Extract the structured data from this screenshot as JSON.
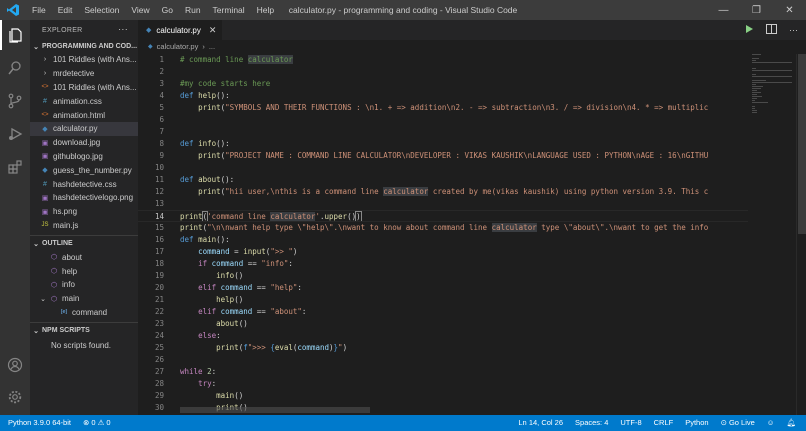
{
  "titlebar": {
    "menu": [
      "File",
      "Edit",
      "Selection",
      "View",
      "Go",
      "Run",
      "Terminal",
      "Help"
    ],
    "title": "calculator.py - programming and coding - Visual Studio Code"
  },
  "sidebar": {
    "header": "EXPLORER",
    "more": "···",
    "folder": "PROGRAMMING AND COD...",
    "files": [
      {
        "name": "101 Riddles (with Ans...",
        "icon": "folder-icon",
        "glyph": "›",
        "color": "#cccccc",
        "chevron": true
      },
      {
        "name": "mrdetective",
        "icon": "folder-icon",
        "glyph": "›",
        "color": "#cccccc",
        "chevron": true
      },
      {
        "name": "101 Riddles (with Ans...",
        "icon": "html-file-icon",
        "glyph": "<>",
        "color": "#e37933"
      },
      {
        "name": "animation.css",
        "icon": "css-file-icon",
        "glyph": "#",
        "color": "#519aba"
      },
      {
        "name": "animation.html",
        "icon": "html-file-icon",
        "glyph": "<>",
        "color": "#e37933"
      },
      {
        "name": "calculator.py",
        "icon": "python-file-icon",
        "glyph": "◆",
        "color": "#4584b6",
        "selected": true
      },
      {
        "name": "download.jpg",
        "icon": "image-file-icon",
        "glyph": "▣",
        "color": "#a074c4"
      },
      {
        "name": "githublogo.jpg",
        "icon": "image-file-icon",
        "glyph": "▣",
        "color": "#a074c4"
      },
      {
        "name": "guess_the_number.py",
        "icon": "python-file-icon",
        "glyph": "◆",
        "color": "#4584b6"
      },
      {
        "name": "hashdetective.css",
        "icon": "css-file-icon",
        "glyph": "#",
        "color": "#519aba"
      },
      {
        "name": "hashdetectivelogo.png",
        "icon": "image-file-icon",
        "glyph": "▣",
        "color": "#a074c4"
      },
      {
        "name": "hs.png",
        "icon": "image-file-icon",
        "glyph": "▣",
        "color": "#a074c4"
      },
      {
        "name": "main.js",
        "icon": "js-file-icon",
        "glyph": "JS",
        "color": "#cbcb41"
      }
    ],
    "outline_header": "OUTLINE",
    "outline": [
      {
        "name": "about",
        "indent": 1
      },
      {
        "name": "help",
        "indent": 1
      },
      {
        "name": "info",
        "indent": 1
      },
      {
        "name": "main",
        "indent": 1,
        "chevron": true
      },
      {
        "name": "command",
        "indent": 2,
        "variable": true
      }
    ],
    "npm_header": "NPM SCRIPTS",
    "npm_empty": "No scripts found."
  },
  "editor": {
    "tab": "calculator.py",
    "breadcrumb": [
      "calculator.py",
      "..."
    ],
    "current_line": 14,
    "lines": [
      {
        "n": 1,
        "html": "<span class='c-com'># command line <span class='hl'>calculator</span></span>"
      },
      {
        "n": 2,
        "html": ""
      },
      {
        "n": 3,
        "html": "<span class='c-com'>#my code starts here</span>"
      },
      {
        "n": 4,
        "html": "<span class='c-kw'>def</span> <span class='c-fn'>help</span>():"
      },
      {
        "n": 5,
        "html": "    <span class='c-fn'>print</span>(<span class='c-str'>\"SYMBOLS AND THEIR FUNCTIONS : \\n1. + =&gt; addition\\n2. - =&gt; subtraction\\n3. / =&gt; division\\n4. * =&gt; multiplic</span>"
      },
      {
        "n": 6,
        "html": ""
      },
      {
        "n": 7,
        "html": ""
      },
      {
        "n": 8,
        "html": "<span class='c-kw'>def</span> <span class='c-fn'>info</span>():"
      },
      {
        "n": 9,
        "html": "    <span class='c-fn'>print</span>(<span class='c-str'>\"PROJECT NAME : COMMAND LINE CALCULATOR\\nDEVELOPER : VIKAS KAUSHIK\\nLANGUAGE USED : PYTHON\\nAGE : 16\\nGITHU</span>"
      },
      {
        "n": 10,
        "html": ""
      },
      {
        "n": 11,
        "html": "<span class='c-kw'>def</span> <span class='c-fn'>about</span>():"
      },
      {
        "n": 12,
        "html": "    <span class='c-fn'>print</span>(<span class='c-str'>\"hii user,\\nthis is a command line <span class='hl'>calculator</span> created by me(vikas kaushik) using python version 3.9. This c</span>"
      },
      {
        "n": 13,
        "html": ""
      },
      {
        "n": 14,
        "html": "<span class='c-fn'>print</span><span style='outline:1px solid #888'>(</span><span class='c-str'>'command line <span class='hl'>calculator</span>'</span>.<span class='c-fn'>upper</span>()<span style='outline:1px solid #888'>)</span>"
      },
      {
        "n": 15,
        "html": "<span class='c-fn'>print</span>(<span class='c-str'>\"\\n\\nwant help type \\\"help\\\".\\nwant to know about command line <span class='hl'>calculator</span> type \\\"about\\\".\\nwant to get the info</span>"
      },
      {
        "n": 16,
        "html": "<span class='c-kw'>def</span> <span class='c-fn'>main</span>():"
      },
      {
        "n": 17,
        "html": "    <span class='c-var'>command</span> = <span class='c-fn'>input</span>(<span class='c-str'>\"&gt;&gt; \"</span>)"
      },
      {
        "n": 18,
        "html": "    <span class='c-ctl'>if</span> <span class='c-var'>command</span> == <span class='c-str'>\"info\"</span>:"
      },
      {
        "n": 19,
        "html": "        <span class='c-fn'>info</span>()"
      },
      {
        "n": 20,
        "html": "    <span class='c-ctl'>elif</span> <span class='c-var'>command</span> == <span class='c-str'>\"help\"</span>:"
      },
      {
        "n": 21,
        "html": "        <span class='c-fn'>help</span>()"
      },
      {
        "n": 22,
        "html": "    <span class='c-ctl'>elif</span> <span class='c-var'>command</span> == <span class='c-str'>\"about\"</span>:"
      },
      {
        "n": 23,
        "html": "        <span class='c-fn'>about</span>()"
      },
      {
        "n": 24,
        "html": "    <span class='c-ctl'>else</span>:"
      },
      {
        "n": 25,
        "html": "        <span class='c-fn'>print</span>(<span class='c-kw'>f</span><span class='c-str'>\"&gt;&gt;&gt; </span><span class='c-brace'>{</span><span class='c-fn'>eval</span>(<span class='c-var'>command</span>)<span class='c-brace'>}</span><span class='c-str'>\"</span>)"
      },
      {
        "n": 26,
        "html": ""
      },
      {
        "n": 27,
        "html": "<span class='c-ctl'>while</span> <span class='c-num'>2</span>:"
      },
      {
        "n": 28,
        "html": "    <span class='c-ctl'>try</span>:"
      },
      {
        "n": 29,
        "html": "        <span class='c-fn'>main</span>()"
      },
      {
        "n": 30,
        "html": "        <span class='c-fn'>print</span>()"
      }
    ]
  },
  "statusbar": {
    "python": "Python 3.9.0 64-bit",
    "problems": "⊗ 0  ⚠ 0",
    "position": "Ln 14, Col 26",
    "spaces": "Spaces: 4",
    "encoding": "UTF-8",
    "eol": "CRLF",
    "language": "Python",
    "golive": "⊙ Go Live"
  }
}
